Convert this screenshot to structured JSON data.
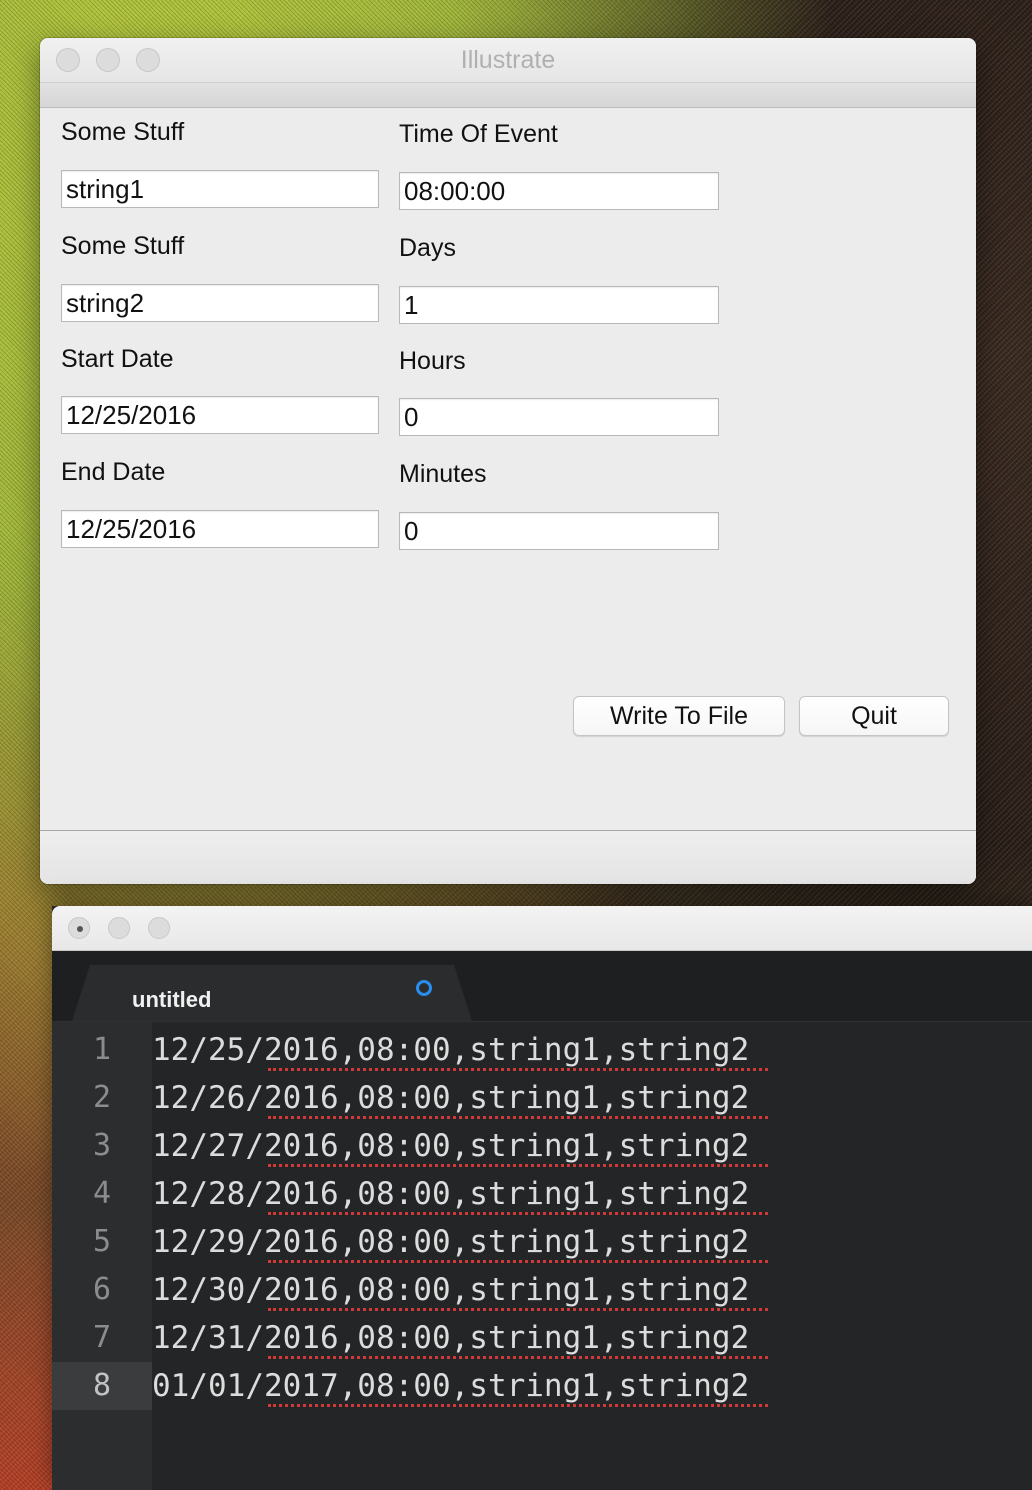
{
  "dialog": {
    "title": "Illustrate",
    "labels": {
      "some_stuff_1": "Some Stuff",
      "some_stuff_2": "Some Stuff",
      "start_date": "Start Date",
      "end_date": "End Date",
      "time_of_event": "Time Of Event",
      "days": "Days",
      "hours": "Hours",
      "minutes": "Minutes"
    },
    "values": {
      "some_stuff_1": "string1",
      "some_stuff_2": "string2",
      "start_date": "12/25/2016",
      "end_date": "12/25/2016",
      "time_of_event": "08:00:00",
      "days": "1",
      "hours": "0",
      "minutes": "0"
    },
    "buttons": {
      "write": "Write To File",
      "quit": "Quit"
    }
  },
  "editor": {
    "tab_label": "untitled",
    "modified_indicator_color": "#2a8ef0",
    "lines": [
      {
        "num": "1",
        "text": "12/25/2016,08:00,string1,string2"
      },
      {
        "num": "2",
        "text": "12/26/2016,08:00,string1,string2"
      },
      {
        "num": "3",
        "text": "12/27/2016,08:00,string1,string2"
      },
      {
        "num": "4",
        "text": "12/28/2016,08:00,string1,string2"
      },
      {
        "num": "5",
        "text": "12/29/2016,08:00,string1,string2"
      },
      {
        "num": "6",
        "text": "12/30/2016,08:00,string1,string2"
      },
      {
        "num": "7",
        "text": "12/31/2016,08:00,string1,string2"
      },
      {
        "num": "8",
        "text": "01/01/2017,08:00,string1,string2"
      }
    ],
    "active_line": "8"
  }
}
